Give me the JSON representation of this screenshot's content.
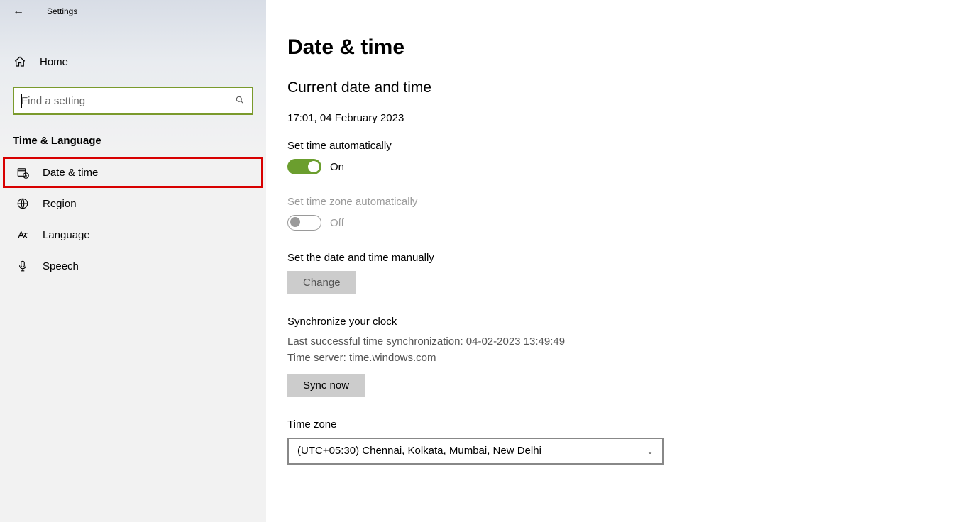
{
  "titlebar": {
    "label": "Settings"
  },
  "sidebar": {
    "home": "Home",
    "search_placeholder": "Find a setting",
    "section": "Time & Language",
    "items": [
      {
        "label": "Date & time"
      },
      {
        "label": "Region"
      },
      {
        "label": "Language"
      },
      {
        "label": "Speech"
      }
    ]
  },
  "main": {
    "title": "Date & time",
    "current_heading": "Current date and time",
    "current_value": "17:01, 04 February 2023",
    "auto_time": {
      "label": "Set time automatically",
      "state": "On"
    },
    "auto_tz": {
      "label": "Set time zone automatically",
      "state": "Off"
    },
    "manual": {
      "label": "Set the date and time manually",
      "button": "Change"
    },
    "sync": {
      "heading": "Synchronize your clock",
      "line1": "Last successful time synchronization: 04-02-2023 13:49:49",
      "line2": "Time server: time.windows.com",
      "button": "Sync now"
    },
    "tz": {
      "label": "Time zone",
      "value": "(UTC+05:30) Chennai, Kolkata, Mumbai, New Delhi"
    }
  }
}
